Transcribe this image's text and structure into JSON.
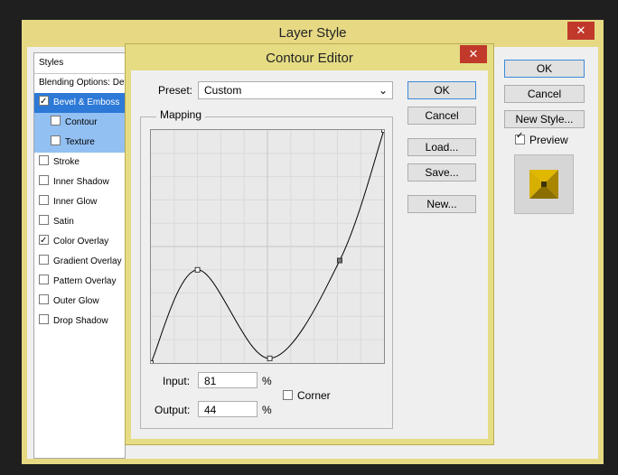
{
  "layer_style": {
    "title": "Layer Style",
    "close": "✕",
    "styles_header": "Styles",
    "items": [
      {
        "label": "Blending Options: Default",
        "checked": null
      },
      {
        "label": "Bevel & Emboss",
        "checked": true
      },
      {
        "label": "Contour",
        "checked": false
      },
      {
        "label": "Texture",
        "checked": false
      },
      {
        "label": "Stroke",
        "checked": false
      },
      {
        "label": "Inner Shadow",
        "checked": false
      },
      {
        "label": "Inner Glow",
        "checked": false
      },
      {
        "label": "Satin",
        "checked": false
      },
      {
        "label": "Color Overlay",
        "checked": true
      },
      {
        "label": "Gradient Overlay",
        "checked": false
      },
      {
        "label": "Pattern Overlay",
        "checked": false
      },
      {
        "label": "Outer Glow",
        "checked": false
      },
      {
        "label": "Drop Shadow",
        "checked": false
      }
    ],
    "buttons": {
      "ok": "OK",
      "cancel": "Cancel",
      "new_style": "New Style..."
    },
    "preview_label": "Preview",
    "preview_checked": true
  },
  "contour_editor": {
    "title": "Contour Editor",
    "close": "✕",
    "preset_label": "Preset:",
    "preset_value": "Custom",
    "mapping_label": "Mapping",
    "input_label": "Input:",
    "input_value": "81",
    "output_label": "Output:",
    "output_value": "44",
    "percent": "%",
    "corner_label": "Corner",
    "corner_checked": false,
    "buttons": {
      "ok": "OK",
      "cancel": "Cancel",
      "load": "Load...",
      "save": "Save...",
      "new": "New..."
    },
    "curve_points": [
      [
        0,
        0
      ],
      [
        20,
        40
      ],
      [
        51,
        2
      ],
      [
        81,
        44
      ],
      [
        100,
        100
      ]
    ]
  },
  "colors": {
    "window_frame": "#e7d984",
    "close": "#c0392b",
    "selection": "#2c79d7",
    "sub_selection": "#92c0f2",
    "preview_gold": "#c9a400"
  }
}
